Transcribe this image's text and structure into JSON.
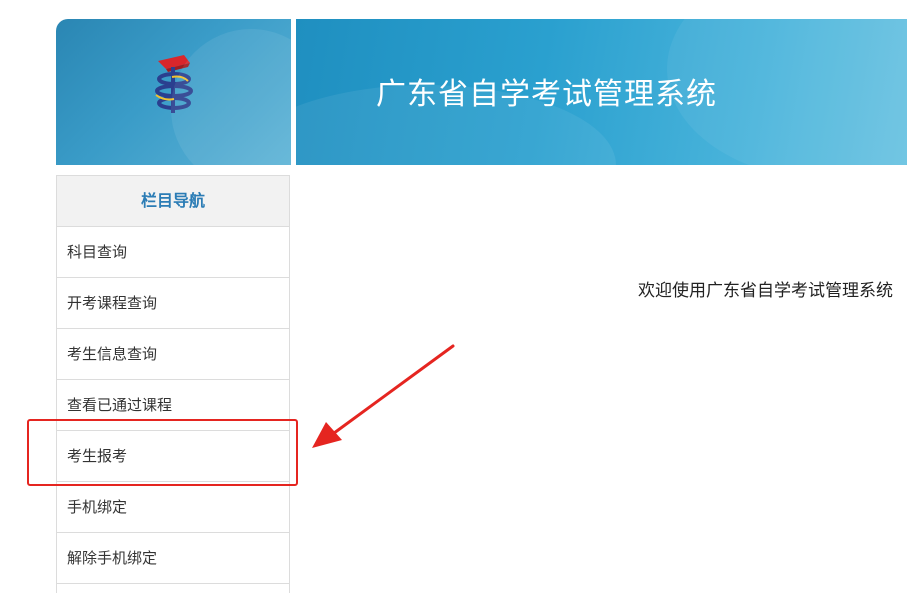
{
  "header": {
    "system_title": "广东省自学考试管理系统",
    "logo": "gd-self-study-exam-logo"
  },
  "sidebar": {
    "title": "栏目导航",
    "items": [
      {
        "label": "科目查询"
      },
      {
        "label": "开考课程查询"
      },
      {
        "label": "考生信息查询"
      },
      {
        "label": "查看已通过课程"
      },
      {
        "label": "考生报考"
      },
      {
        "label": "手机绑定"
      },
      {
        "label": "解除手机绑定"
      }
    ]
  },
  "main": {
    "welcome_text": "欢迎使用广东省自学考试管理系统"
  },
  "annotation": {
    "highlighted_item": "考生报考",
    "color": "#e52520"
  },
  "colors": {
    "header_blue": "#2aa0cf",
    "nav_title": "#2b7cb5",
    "logo_red": "#d9262b",
    "logo_navy": "#2a3f8f"
  }
}
